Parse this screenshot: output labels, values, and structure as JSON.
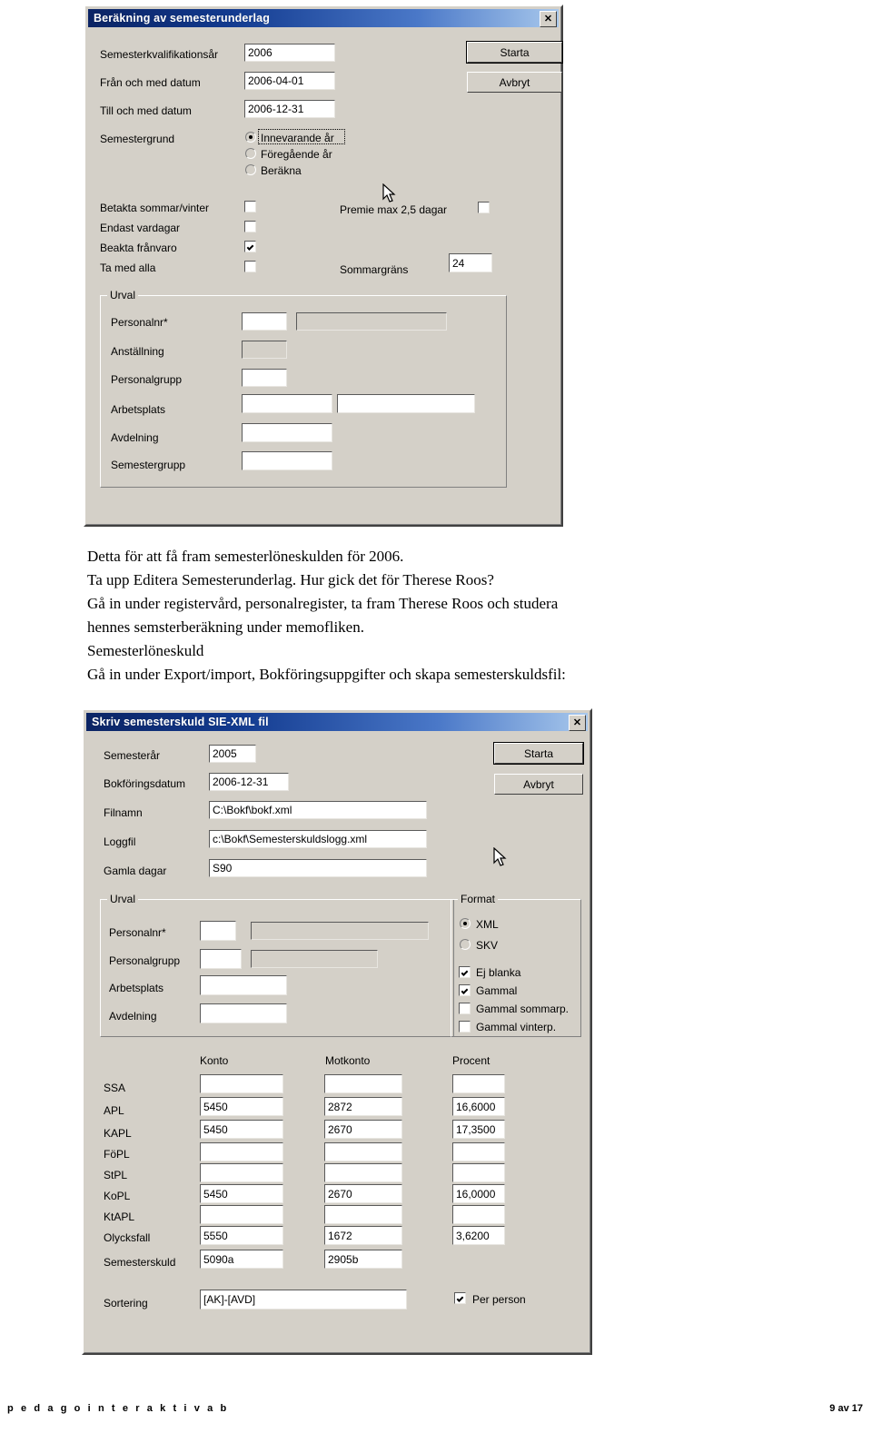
{
  "dialog1": {
    "title": "Beräkning av semesterunderlag",
    "close_icon": "close-icon",
    "fields": [
      {
        "label": "Semesterkvalifikationsår",
        "value": "2006"
      },
      {
        "label": "Från och med datum",
        "value": "2006-04-01"
      },
      {
        "label": "Till och med datum",
        "value": "2006-12-31"
      }
    ],
    "radio_group": {
      "label": "Semestergrund",
      "options": [
        {
          "label": "Innevarande år",
          "selected": true
        },
        {
          "label": "Föregående år",
          "selected": false
        },
        {
          "label": "Beräkna",
          "selected": false
        }
      ]
    },
    "checkboxes_left": [
      {
        "label": "Betakta sommar/vinter",
        "checked": false
      },
      {
        "label": "Endast vardagar",
        "checked": false
      },
      {
        "label": "Beakta frånvaro",
        "checked": true
      },
      {
        "label": "Ta med alla",
        "checked": false
      }
    ],
    "checkbox_premie": {
      "label": "Premie max 2,5 dagar",
      "checked": false
    },
    "sommargrans": {
      "label": "Sommargräns",
      "value": "24"
    },
    "buttons": {
      "start": "Starta",
      "cancel": "Avbryt"
    },
    "urval": {
      "title": "Urval",
      "rows": [
        {
          "label": "Personalnr*",
          "value": "",
          "second": "",
          "second_disabled": true
        },
        {
          "label": "Anställning",
          "value": "",
          "disabled": true
        },
        {
          "label": "Personalgrupp",
          "value": ""
        },
        {
          "label": "Arbetsplats",
          "value": "",
          "second": ""
        },
        {
          "label": "Avdelning",
          "value": ""
        },
        {
          "label": "Semestergrupp",
          "value": ""
        }
      ]
    }
  },
  "prose": {
    "lines": [
      "Detta för att få fram semesterlöneskulden för 2006.",
      "Ta upp Editera Semesterunderlag. Hur gick det för Therese Roos?",
      "Gå in under registervård, personalregister, ta fram Therese Roos och studera",
      "hennes semsterberäkning under memofliken.",
      "Semesterlöneskuld",
      "Gå in under Export/import, Bokföringsuppgifter och skapa semesterskuldsfil:"
    ]
  },
  "dialog2": {
    "title": "Skriv semesterskuld SIE-XML fil",
    "close_icon": "close-icon",
    "fields": [
      {
        "label": "Semesterår",
        "value": "2005"
      },
      {
        "label": "Bokföringsdatum",
        "value": "2006-12-31"
      },
      {
        "label": "Filnamn",
        "value": "C:\\Bokf\\bokf.xml"
      },
      {
        "label": "Loggfil",
        "value": "c:\\Bokf\\Semesterskuldslogg.xml"
      },
      {
        "label": "Gamla dagar",
        "value": "S90"
      }
    ],
    "buttons": {
      "start": "Starta",
      "cancel": "Avbryt"
    },
    "urval": {
      "title": "Urval",
      "rows": [
        {
          "label": "Personalnr*",
          "value": "",
          "second": "",
          "second_disabled": true
        },
        {
          "label": "Personalgrupp",
          "value": "",
          "second": "",
          "second_disabled": true
        },
        {
          "label": "Arbetsplats",
          "value": ""
        },
        {
          "label": "Avdelning",
          "value": ""
        }
      ]
    },
    "format": {
      "title": "Format",
      "radios": [
        {
          "label": "XML",
          "selected": true
        },
        {
          "label": "SKV",
          "selected": false
        }
      ],
      "checkboxes": [
        {
          "label": "Ej blanka",
          "checked": true
        },
        {
          "label": "Gammal",
          "checked": true
        },
        {
          "label": "Gammal sommarp.",
          "checked": false
        },
        {
          "label": "Gammal vinterp.",
          "checked": false
        }
      ]
    },
    "account_table": {
      "headers": [
        "Konto",
        "Motkonto",
        "Procent"
      ],
      "rows": [
        {
          "label": "SSA",
          "konto": "",
          "motkonto": "",
          "procent": ""
        },
        {
          "label": "APL",
          "konto": "5450",
          "motkonto": "2872",
          "procent": "16,6000"
        },
        {
          "label": "KAPL",
          "konto": "5450",
          "motkonto": "2670",
          "procent": "17,3500"
        },
        {
          "label": "FöPL",
          "konto": "",
          "motkonto": "",
          "procent": ""
        },
        {
          "label": "StPL",
          "konto": "",
          "motkonto": "",
          "procent": ""
        },
        {
          "label": "KoPL",
          "konto": "5450",
          "motkonto": "2670",
          "procent": "16,0000"
        },
        {
          "label": "KtAPL",
          "konto": "",
          "motkonto": "",
          "procent": ""
        },
        {
          "label": "Olycksfall",
          "konto": "5550",
          "motkonto": "1672",
          "procent": "3,6200"
        },
        {
          "label": "Semesterskuld",
          "konto": "5090a",
          "motkonto": "2905b",
          "procent": null
        }
      ]
    },
    "sortering": {
      "label": "Sortering",
      "value": "[AK]-[AVD]"
    },
    "per_person": {
      "label": "Per person",
      "checked": true
    }
  },
  "footer": {
    "left": "p e d a g o   i n t e r a k t i v   a b",
    "right": "9 av 17"
  }
}
